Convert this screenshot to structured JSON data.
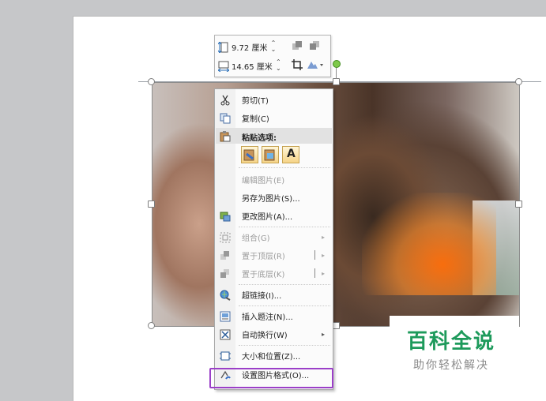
{
  "toolbar": {
    "height_value": "9.72 厘米",
    "width_value": "14.65 厘米",
    "spinner_glyph": "⌃⌄"
  },
  "menu": {
    "cut": "剪切(T)",
    "copy": "复制(C)",
    "paste_options_header": "粘贴选项:",
    "paste_text_button": "A",
    "edit_picture": "编辑图片(E)",
    "save_as_picture": "另存为图片(S)...",
    "change_picture": "更改图片(A)...",
    "group": "组合(G)",
    "bring_to_front": "置于顶层(R)",
    "send_to_back": "置于底层(K)",
    "hyperlink": "超链接(I)...",
    "insert_caption": "插入题注(N)...",
    "wrap_text": "自动换行(W)",
    "size_position": "大小和位置(Z)...",
    "format_picture": "设置图片格式(O)..."
  },
  "watermark": {
    "title": "百科全说",
    "subtitle": "助你轻松解决"
  },
  "colors": {
    "highlight_box": "#9b3fc8",
    "watermark_green": "#1d9a5b",
    "rotate_handle": "#7ec94a"
  },
  "icons": [
    "scissors-icon",
    "copy-icon",
    "paste-icon",
    "paste-keep-format-icon",
    "paste-picture-icon",
    "paste-text-icon",
    "change-picture-icon",
    "group-icon",
    "bring-front-icon",
    "send-back-icon",
    "hyperlink-icon",
    "caption-icon",
    "wrap-text-icon",
    "size-position-icon",
    "format-picture-icon",
    "crop-icon",
    "height-icon",
    "width-icon"
  ]
}
